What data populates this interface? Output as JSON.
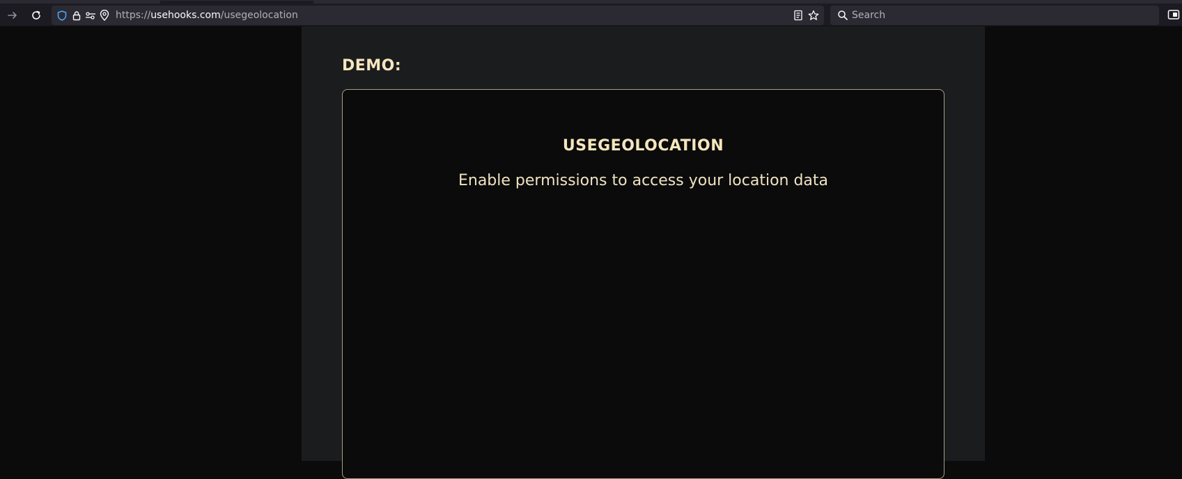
{
  "browser": {
    "url_prefix": "https://",
    "url_host": "usehooks.com",
    "url_path": "/usegeolocation",
    "search_placeholder": "Search",
    "icons": [
      "forward-icon",
      "reload-icon",
      "shield-icon",
      "lock-icon",
      "permissions-icon",
      "location-icon",
      "reader-view-icon",
      "bookmark-star-icon",
      "search-icon",
      "extensions-icon"
    ]
  },
  "page": {
    "demo_heading": "DEMO:",
    "demo_title": "USEGEOLOCATION",
    "demo_message": "Enable permissions to access your location data"
  },
  "colors": {
    "accent_text": "#f5e6bd",
    "page_background": "#0b0b0c",
    "column_background": "#1b1c1e",
    "box_border": "#a89f86"
  }
}
